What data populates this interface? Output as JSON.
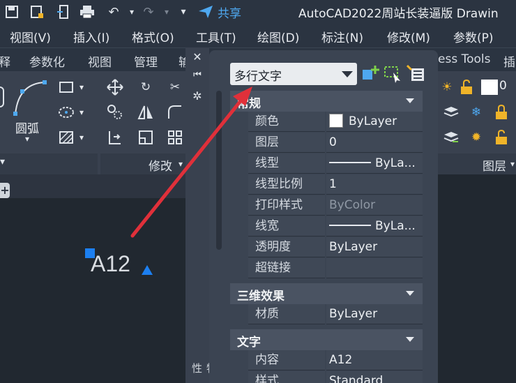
{
  "titlebar": {
    "share_label": "共享",
    "app_title": "AutoCAD2022周站长装逼版   Drawin"
  },
  "menubar": {
    "items": [
      "视图(V)",
      "插入(I)",
      "格式(O)",
      "工具(T)",
      "绘图(D)",
      "标注(N)",
      "修改(M)",
      "参数(P)"
    ]
  },
  "ribbon_tabs": {
    "items": [
      "释",
      "参数化",
      "视图",
      "管理",
      "输",
      "ess Tools",
      "插"
    ]
  },
  "ribbon": {
    "arc_label": "圆弧",
    "modify_panel": "修改",
    "layer_panel": "图层",
    "layer_value": "0"
  },
  "canvas": {
    "text_object": "A12"
  },
  "palette": {
    "object_type": "多行文字",
    "strip_label": "特性",
    "sections": {
      "general": "常规",
      "threed": "三维效果",
      "text": "文字"
    },
    "general_rows": [
      {
        "name": "颜色",
        "value": "ByLayer"
      },
      {
        "name": "图层",
        "value": "0"
      },
      {
        "name": "线型",
        "value": "ByLa..."
      },
      {
        "name": "线型比例",
        "value": "1"
      },
      {
        "name": "打印样式",
        "value": "ByColor"
      },
      {
        "name": "线宽",
        "value": "ByLa..."
      },
      {
        "name": "透明度",
        "value": "ByLayer"
      },
      {
        "name": "超链接",
        "value": ""
      }
    ],
    "threed_rows": [
      {
        "name": "材质",
        "value": "ByLayer"
      }
    ],
    "text_rows": [
      {
        "name": "内容",
        "value": "A12"
      },
      {
        "name": "样式",
        "value": "Standard"
      }
    ]
  },
  "colors": {
    "accent_blue": "#1c7ff0",
    "arrow_red": "#e0303a"
  }
}
